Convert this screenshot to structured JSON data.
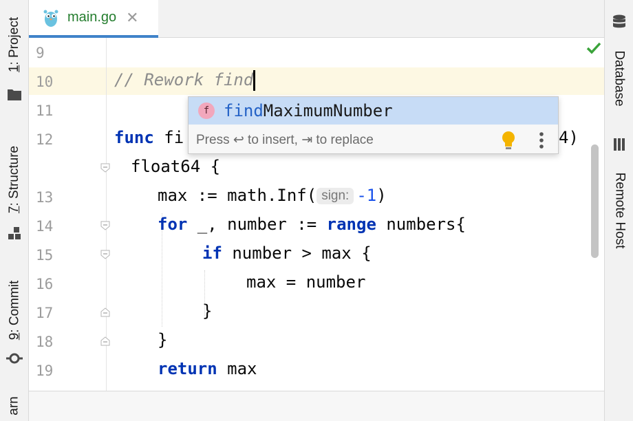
{
  "left_toolbar": {
    "tabs": [
      {
        "number": "1",
        "label": ": Project"
      },
      {
        "number": "7",
        "label": ": Structure"
      },
      {
        "number": "9",
        "label": ": Commit"
      },
      {
        "label": "arn"
      }
    ]
  },
  "right_toolbar": {
    "tabs": [
      {
        "label": "Database"
      },
      {
        "label": "Remote Host"
      }
    ]
  },
  "editor_tab": {
    "filename": "main.go",
    "close_glyph": "✕"
  },
  "inspection_status": {
    "icon": "check-icon",
    "color": "#3aa33a"
  },
  "gutter": {
    "line_numbers": [
      "9",
      "10",
      "11",
      "12",
      "13",
      "14",
      "15",
      "16",
      "17",
      "18",
      "19"
    ]
  },
  "code": {
    "comment": "// Rework find",
    "line12_kw": "func",
    "line12_name": " fi",
    "line12_tail": "4)",
    "line12b": "float64 {",
    "line13_a": "max := math.Inf(",
    "line13_hint": "sign:",
    "line13_num": "-1",
    "line13_b": ")",
    "line14_kw1": "for",
    "line14_a": " _, number := ",
    "line14_kw2": "range",
    "line14_b": " numbers{",
    "line15_kw": "if",
    "line15_a": " number > max {",
    "line16": "max = number",
    "line17": "}",
    "line18": "}",
    "line19_kw": "return",
    "line19_a": " max"
  },
  "completion_popup": {
    "item_icon_letter": "f",
    "item_match": "find",
    "item_rest": "MaximumNumber",
    "footer_text": "Press ↩ to insert, ⇥ to replace",
    "bulb_color": "#f4b400"
  },
  "colors": {
    "keyword": "#0033b3",
    "comment": "#8c8c8c",
    "number": "#1750eb",
    "tab_text": "#247d2e",
    "tab_underline": "#4083c9",
    "current_line": "#fdf8e3",
    "popup_selection": "#c7dcf6"
  }
}
